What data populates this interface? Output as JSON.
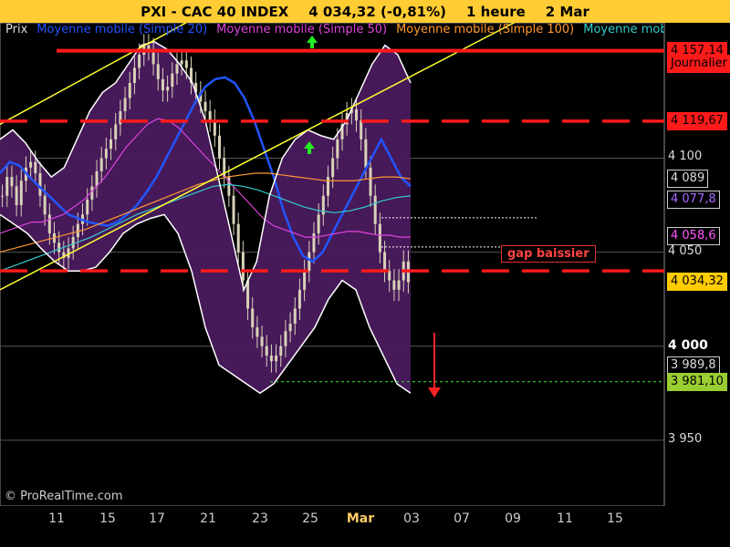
{
  "header": {
    "instrument": "PXI - CAC 40 INDEX",
    "quote": "4 034,32 (-0,81%)",
    "period": "1 heure",
    "date": "2 Mar"
  },
  "legend": {
    "items": [
      {
        "label": "Prix",
        "color": "#dddddd"
      },
      {
        "label": "Moyenne mobile (Simple 20)",
        "color": "#2255ff"
      },
      {
        "label": "Moyenne mobile (Simple 50)",
        "color": "#dd44dd"
      },
      {
        "label": "Moyenne mobile (Simple 100)",
        "color": "#ff9933"
      },
      {
        "label": "Moyenne mobile",
        "color": "#33cccc"
      }
    ]
  },
  "copyright": "© ProRealTime.com",
  "annotation": {
    "gap_label": "gap baissier"
  },
  "price_tags": [
    {
      "text": "4 157,14",
      "value": 4157.14,
      "bg": "#ff1a1a",
      "fg": "#000000"
    },
    {
      "text": "Journalier",
      "value": 4150,
      "bg": "#ff1a1a",
      "fg": "#000000"
    },
    {
      "text": "4 119,67",
      "value": 4119.67,
      "bg": "#ff1a1a",
      "fg": "#000000"
    },
    {
      "text": "4 089",
      "value": 4089,
      "bg": "#000000",
      "fg": "#dddddd"
    },
    {
      "text": "4 077,8",
      "value": 4077.8,
      "bg": "#000000",
      "fg": "#aa66ff"
    },
    {
      "text": "4 058,6",
      "value": 4058.6,
      "bg": "#000000",
      "fg": "#ff55ff"
    },
    {
      "text": "4 034,32",
      "value": 4034.32,
      "bg": "#ffcc00",
      "fg": "#000000"
    },
    {
      "text": "3 989,8",
      "value": 3989.8,
      "bg": "#000000",
      "fg": "#dddddd"
    },
    {
      "text": "3 981,10",
      "value": 3981.1,
      "bg": "#9acd32",
      "fg": "#000000"
    }
  ],
  "chart_data": {
    "type": "line",
    "title": "PXI - CAC 40 INDEX",
    "ylim": [
      3915,
      4172
    ],
    "y_ticks": [
      {
        "label": "4 100",
        "value": 4100,
        "bold": false
      },
      {
        "label": "4 050",
        "value": 4050,
        "bold": false
      },
      {
        "label": "4 000",
        "value": 4000,
        "bold": true
      },
      {
        "label": "3 950",
        "value": 3950,
        "bold": false
      }
    ],
    "x_ticks": [
      "11",
      "15",
      "17",
      "21",
      "23",
      "25",
      "Mar",
      "03",
      "07",
      "09",
      "11",
      "15"
    ],
    "x_tick_month_index": 6,
    "horizontal_levels": [
      {
        "value": 4157.14,
        "style": "solid",
        "color": "#ff1a1a"
      },
      {
        "value": 4119.67,
        "style": "dashed",
        "color": "#ff1a1a"
      },
      {
        "value": 4040.04,
        "style": "dashed",
        "color": "#ff1a1a"
      },
      {
        "value": 3981.1,
        "style": "dotted",
        "color": "#33cc33"
      }
    ],
    "price_close": [
      4080,
      4090,
      4085,
      4075,
      4088,
      4095,
      4098,
      4092,
      4080,
      4070,
      4060,
      4055,
      4050,
      4047,
      4052,
      4058,
      4065,
      4070,
      4078,
      4085,
      4093,
      4100,
      4105,
      4110,
      4118,
      4125,
      4132,
      4140,
      4148,
      4155,
      4160,
      4158,
      4150,
      4142,
      4136,
      4138,
      4145,
      4150,
      4152,
      4148,
      4140,
      4135,
      4130,
      4125,
      4120,
      4112,
      4100,
      4090,
      4080,
      4065,
      4050,
      4035,
      4020,
      4010,
      4005,
      4000,
      3995,
      3992,
      3995,
      4000,
      4008,
      4012,
      4020,
      4030,
      4040,
      4050,
      4060,
      4070,
      4080,
      4090,
      4100,
      4110,
      4118,
      4124,
      4126,
      4120,
      4110,
      4095,
      4080,
      4065,
      4050,
      4040,
      4035,
      4030,
      4035,
      4045,
      4034
    ],
    "series": [
      {
        "name": "Moyenne mobile (Simple 20)",
        "color": "#2255ff",
        "values": [
          4092,
          4098,
          4096,
          4090,
          4085,
          4080,
          4075,
          4070,
          4068,
          4066,
          4065,
          4064,
          4066,
          4070,
          4075,
          4082,
          4090,
          4100,
          4110,
          4120,
          4130,
          4138,
          4142,
          4143,
          4140,
          4132,
          4120,
          4105,
          4090,
          4072,
          4058,
          4048,
          4045,
          4050,
          4060,
          4070,
          4080,
          4090,
          4100,
          4110,
          4100,
          4090,
          4085
        ]
      },
      {
        "name": "Moyenne mobile (Simple 50)",
        "color": "#dd44dd",
        "values": [
          4060,
          4062,
          4064,
          4066,
          4066,
          4068,
          4070,
          4074,
          4078,
          4084,
          4090,
          4098,
          4106,
          4112,
          4118,
          4121,
          4120,
          4116,
          4110,
          4104,
          4098,
          4092,
          4086,
          4080,
          4074,
          4068,
          4064,
          4062,
          4060,
          4058,
          4058,
          4059,
          4060,
          4061,
          4061,
          4060,
          4059,
          4059,
          4058,
          4058
        ]
      },
      {
        "name": "Moyenne mobile (Simple 100)",
        "color": "#ff9933",
        "values": [
          4050,
          4052,
          4054,
          4056,
          4058,
          4060,
          4062,
          4065,
          4068,
          4071,
          4074,
          4077,
          4080,
          4083,
          4086,
          4088,
          4090,
          4091,
          4092,
          4092,
          4091,
          4090,
          4089,
          4088,
          4088,
          4088,
          4089,
          4090,
          4090,
          4089
        ]
      },
      {
        "name": "Moyenne mobile",
        "color": "#33cccc",
        "values": [
          4040,
          4043,
          4046,
          4049,
          4052,
          4055,
          4058,
          4062,
          4066,
          4070,
          4073,
          4076,
          4079,
          4082,
          4085,
          4086,
          4085,
          4083,
          4080,
          4077,
          4074,
          4072,
          4071,
          4072,
          4074,
          4077,
          4079,
          4080
        ]
      },
      {
        "name": "Bollinger upper",
        "color": "#ffffff",
        "values": [
          4110,
          4115,
          4108,
          4098,
          4090,
          4095,
          4110,
          4125,
          4135,
          4140,
          4150,
          4160,
          4162,
          4158,
          4150,
          4140,
          4120,
          4090,
          4060,
          4030,
          4045,
          4080,
          4100,
          4110,
          4115,
          4112,
          4110,
          4120,
          4135,
          4150,
          4160,
          4155,
          4140
        ]
      },
      {
        "name": "Bollinger lower",
        "color": "#ffffff",
        "values": [
          4070,
          4065,
          4060,
          4052,
          4045,
          4040,
          4040,
          4042,
          4050,
          4060,
          4065,
          4068,
          4070,
          4060,
          4040,
          4010,
          3990,
          3985,
          3980,
          3975,
          3980,
          3990,
          4000,
          4010,
          4025,
          4035,
          4030,
          4010,
          3995,
          3980,
          3975
        ]
      }
    ],
    "channel_lines": [
      {
        "color": "#ffff33",
        "from": [
          0,
          4118
        ],
        "to": [
          0.28,
          4172
        ]
      },
      {
        "color": "#ffff33",
        "from": [
          0,
          4030
        ],
        "to": [
          0.79,
          4175
        ]
      }
    ],
    "grid": true
  }
}
